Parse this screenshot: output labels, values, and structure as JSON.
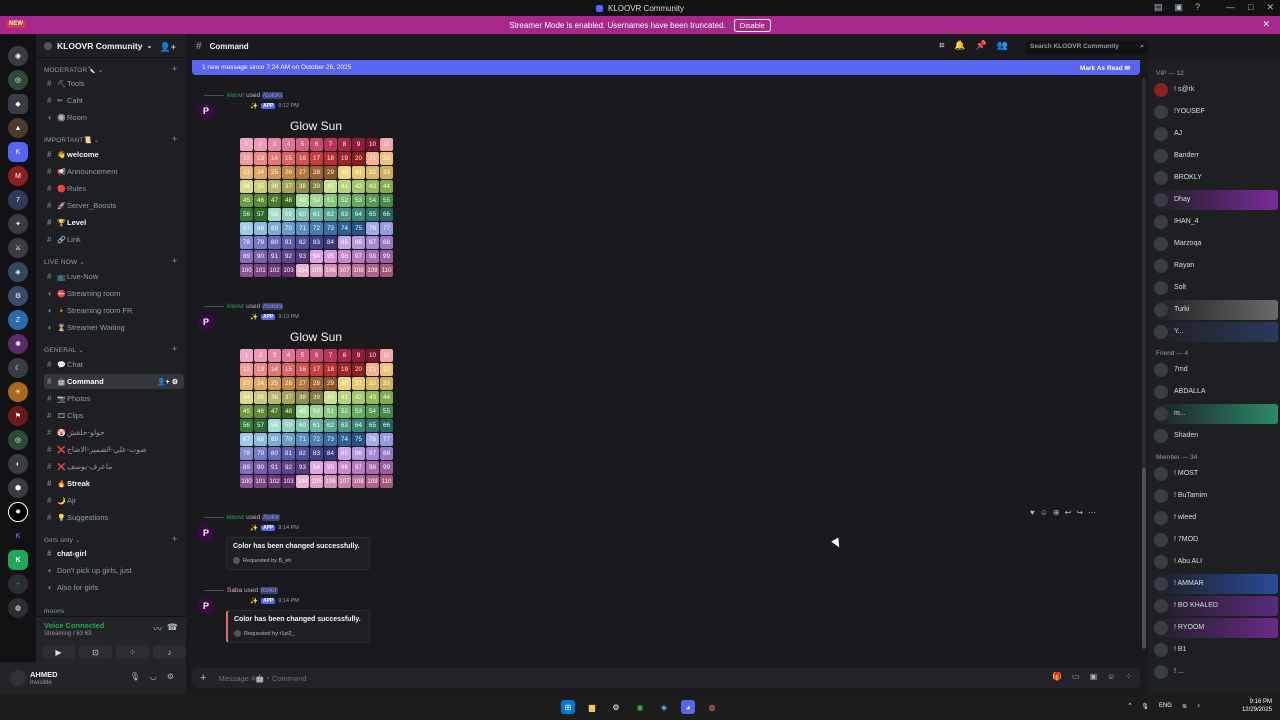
{
  "window": {
    "title": "KLOOVR Community"
  },
  "banner": {
    "text": "Streamer Mode is enabled. Usernames have been truncated.",
    "button": "Disable"
  },
  "new_badge": "NEW",
  "server": {
    "name": "KLOOVR Community"
  },
  "categories": {
    "moderator": "MODERATOR🔪",
    "important": "IMPORTANT📜",
    "live_now": "LIVE NOW",
    "general": "GENERAL",
    "girls_only": "Girls only",
    "more": "moons"
  },
  "channels": [
    {
      "id": "tools",
      "label": "Tools",
      "emoji": "⛏"
    },
    {
      "id": "caht",
      "label": "Caht",
      "emoji": "✏"
    },
    {
      "id": "room",
      "label": "Room",
      "emoji": "🔘"
    },
    {
      "id": "welcome",
      "label": "welcome",
      "emoji": "👋"
    },
    {
      "id": "announcement",
      "label": "Announcement",
      "emoji": "📢"
    },
    {
      "id": "rules",
      "label": "Rules",
      "emoji": "🔴"
    },
    {
      "id": "server_boosts",
      "label": "Server_Boosts",
      "emoji": "🚀"
    },
    {
      "id": "level",
      "label": "Level",
      "emoji": "🏆"
    },
    {
      "id": "link",
      "label": "Link",
      "emoji": "🔗"
    },
    {
      "id": "live_now",
      "label": "Live-Now",
      "emoji": "📺"
    },
    {
      "id": "streaming_room",
      "label": "Streaming room",
      "emoji": "⛔"
    },
    {
      "id": "streaming_room_fr",
      "label": "Streaming room FR",
      "emoji": "🔸"
    },
    {
      "id": "streamer_waiting",
      "label": "Streamer Waiting",
      "emoji": "⏳"
    },
    {
      "id": "chat",
      "label": "Chat",
      "emoji": "💬"
    },
    {
      "id": "command",
      "label": "Command",
      "emoji": "🤖"
    },
    {
      "id": "photos",
      "label": "Photos",
      "emoji": "📷"
    },
    {
      "id": "clips",
      "label": "Clips",
      "emoji": "🎞"
    },
    {
      "id": "arabic1",
      "label": "جولو-حلقش",
      "emoji": "🤡"
    },
    {
      "id": "arabic2",
      "label": "صوت-علي-الضمير-الاضاح",
      "emoji": "❌"
    },
    {
      "id": "arabic3",
      "label": "ماعرف-يوسف",
      "emoji": "❌"
    },
    {
      "id": "streak",
      "label": "Streak",
      "emoji": "🔥"
    },
    {
      "id": "ajr",
      "label": "Ajr",
      "emoji": "🌙"
    },
    {
      "id": "suggestions",
      "label": "Suggestions",
      "emoji": "💡"
    },
    {
      "id": "chat_girl",
      "label": "chat-girl",
      "emoji": ""
    },
    {
      "id": "dont_pick",
      "label": "Don't pick up girls, just",
      "emoji": ""
    },
    {
      "id": "also_girls",
      "label": "Also for girls",
      "emoji": ""
    }
  ],
  "voice": {
    "status": "Voice Connected",
    "detail": "Streaming / 63 63"
  },
  "user": {
    "name": "AHMED",
    "status": "Invisible"
  },
  "chat": {
    "channel": "Command",
    "search_placeholder": "Search KLOOVR Community",
    "new_messages": "1 new message since 7:24 AM on October 26, 2025",
    "mark_read": "Mark As Read",
    "composer_placeholder": "Message #🤖・Command"
  },
  "messages": [
    {
      "user": "kloovr",
      "used": "used",
      "command": "colors",
      "time": "9:12 PM",
      "title": "Glow Sun",
      "app": "APP"
    },
    {
      "user": "kloovr",
      "used": "used",
      "command": "colors",
      "time": "9:13 PM",
      "title": "Glow Sun",
      "app": "APP"
    },
    {
      "user": "kloovr",
      "used": "used",
      "command": "color",
      "time": "9:14 PM",
      "embed_title": "Color has been changed successfully.",
      "footer": "Requested by B_eh",
      "app": "APP"
    },
    {
      "user": "Saba",
      "used": "used",
      "command": "color",
      "time": "9:14 PM",
      "embed_title": "Color has been changed successfully.",
      "footer": "Requested by r1pi2_",
      "app": "APP"
    }
  ],
  "grid_numbers": [
    "1",
    "2",
    "3",
    "4",
    "5",
    "6",
    "7",
    "8",
    "9",
    "10",
    "11",
    "12",
    "13",
    "14",
    "15",
    "16",
    "17",
    "18",
    "19",
    "20",
    "21",
    "22",
    "23",
    "24",
    "25",
    "26",
    "27",
    "28",
    "29",
    "30",
    "31",
    "32",
    "33",
    "34",
    "35",
    "36",
    "37",
    "38",
    "39",
    "40",
    "41",
    "42",
    "43",
    "44",
    "45",
    "46",
    "47",
    "48",
    "49",
    "50",
    "51",
    "52",
    "53",
    "54",
    "55",
    "56",
    "57",
    "58",
    "59",
    "60",
    "61",
    "62",
    "63",
    "64",
    "65",
    "66",
    "67",
    "68",
    "69",
    "70",
    "71",
    "72",
    "73",
    "74",
    "75",
    "76",
    "77",
    "78",
    "79",
    "80",
    "81",
    "82",
    "83",
    "84",
    "85",
    "86",
    "87",
    "88",
    "89",
    "90",
    "91",
    "92",
    "93",
    "94",
    "95",
    "96",
    "97",
    "98",
    "99",
    "100",
    "101",
    "102",
    "103",
    "104",
    "105",
    "106",
    "107",
    "108",
    "109",
    "110"
  ],
  "grid_colors": [
    "#f2a6c2",
    "#ee99b8",
    "#e986a8",
    "#e27296",
    "#d95d84",
    "#c84a6e",
    "#b8365c",
    "#a52749",
    "#8f1c3c",
    "#7a1430",
    "#f7a5a5",
    "#f29a9a",
    "#ec8888",
    "#e67676",
    "#df6262",
    "#d64f4f",
    "#c93d3d",
    "#b92f2f",
    "#a52424",
    "#8f1b1b",
    "#f6b28d",
    "#efc27a",
    "#e9b46c",
    "#e0a55c",
    "#d4964e",
    "#c48641",
    "#b27437",
    "#9f642d",
    "#8d5626",
    "#f0d37c",
    "#e8c96f",
    "#dbbb62",
    "#cfaf5a",
    "#dcd88a",
    "#cccc78",
    "#b8b866",
    "#a4a456",
    "#8f8f47",
    "#7b7b3a",
    "#c9e08c",
    "#b8d47a",
    "#a6c768",
    "#94ba57",
    "#83ab48",
    "#719b3b",
    "#608a30",
    "#4f7826",
    "#3f661d",
    "#a9e0a2",
    "#98d391",
    "#86c67f",
    "#74b86e",
    "#63a95e",
    "#539a50",
    "#448a43",
    "#367a37",
    "#2a6a2c",
    "#a2ddd0",
    "#8fd0c2",
    "#7bc2b3",
    "#69b4a5",
    "#58a596",
    "#489688",
    "#39877a",
    "#2c776c",
    "#20675e",
    "#9fc9e8",
    "#8cbbe0",
    "#7aacd6",
    "#689dcb",
    "#578ebf",
    "#477fb2",
    "#3970a3",
    "#2c6194",
    "#215385",
    "#a6a9ea",
    "#9699e0",
    "#8689d4",
    "#7679c8",
    "#676aba",
    "#5a5cab",
    "#4d4f9b",
    "#41438b",
    "#36387b",
    "#c3a6ea",
    "#b597e0",
    "#a687d4",
    "#9778c8",
    "#886aba",
    "#7a5dab",
    "#6c509b",
    "#5e448b",
    "#51397b",
    "#e0a6e4",
    "#d597da",
    "#c887ce",
    "#ba78c2",
    "#ab6ab4",
    "#9c5da6",
    "#8c5097",
    "#7c4487",
    "#6d3978",
    "#5e2f69",
    "#ebb0d0",
    "#e09fc3",
    "#d48fb5",
    "#c880a7",
    "#bb7099",
    "#ad628b",
    "#9f557d",
    "#914870",
    "#823c63",
    "#743157",
    "#66274b",
    "#561e3f"
  ],
  "members": {
    "vip_header": "VIP — 12",
    "friend_header": "Friend — 4",
    "member_header": "Member — 34",
    "vip": [
      "! s@rk",
      "!YOUSEF",
      "AJ",
      "Banderr",
      "BROKLY",
      "Dhay",
      "IHAN_4",
      "Marzoqa",
      "Rayan",
      "Solt",
      "Turki",
      "Y..."
    ],
    "friend": [
      "7md",
      "ABDALLA",
      "m...",
      "Shaden"
    ],
    "member": [
      "! MOST",
      "! BuTamim",
      "! wleed",
      "! 7MOD",
      "! Abu ALI",
      "! AMMAR",
      "! BO KHALED",
      "! RYOOM",
      "! B1",
      "! ..."
    ]
  },
  "taskbar": {
    "lang": "ENG",
    "time": "9:16 PM",
    "date": "12/29/2025"
  }
}
